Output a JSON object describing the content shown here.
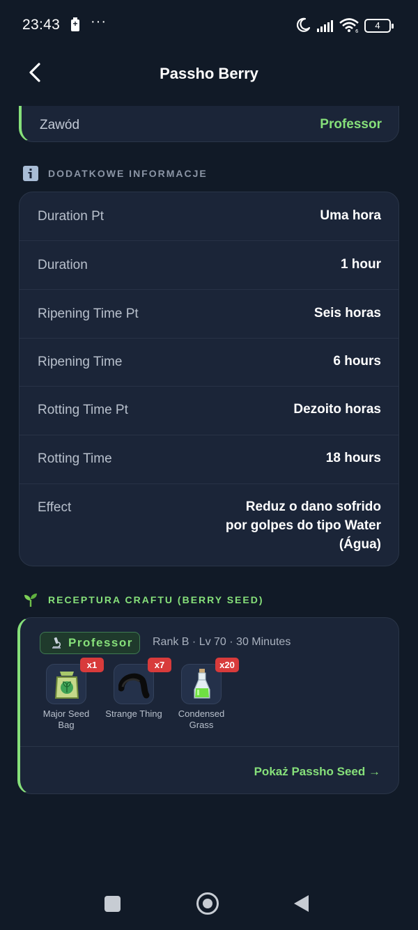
{
  "status_bar": {
    "time": "23:43",
    "more": "···",
    "battery_level": "4"
  },
  "header": {
    "title": "Passho Berry",
    "back_icon": "chevron-left-icon"
  },
  "profession": {
    "label": "Zawód",
    "value": "Professor"
  },
  "additional_info": {
    "section_title": "DODATKOWE INFORMACJE",
    "icon": "info-icon",
    "rows": [
      {
        "label": "Duration Pt",
        "value": "Uma hora"
      },
      {
        "label": "Duration",
        "value": "1 hour"
      },
      {
        "label": "Ripening Time Pt",
        "value": "Seis horas"
      },
      {
        "label": "Ripening Time",
        "value": "6 hours"
      },
      {
        "label": "Rotting Time Pt",
        "value": "Dezoito horas"
      },
      {
        "label": "Rotting Time",
        "value": "18 hours"
      },
      {
        "label": "Effect",
        "value_lines": [
          "Reduz o dano sofrido",
          "por golpes do tipo Water",
          "(Água)"
        ]
      }
    ]
  },
  "craft": {
    "section_title": "RECEPTURA CRAFTU (BERRY SEED)",
    "icon": "sprout-icon",
    "profession_badge": "Professor",
    "rank_info": "Rank B · Lv 70 · 30 Minutes",
    "ingredients": [
      {
        "name": "Major Seed Bag",
        "qty": "x1",
        "icon": "seed-bag-icon"
      },
      {
        "name": "Strange Thing",
        "qty": "x7",
        "icon": "strange-thing-icon"
      },
      {
        "name": "Condensed Grass",
        "qty": "x20",
        "icon": "potion-bottle-icon"
      }
    ],
    "show_link": "Pokaż Passho Seed →"
  },
  "colors": {
    "background": "#111a27",
    "card": "#1b2538",
    "accent_green": "#86e07a",
    "badge_red": "#d83b3b",
    "section_gray": "#8b95a5"
  }
}
